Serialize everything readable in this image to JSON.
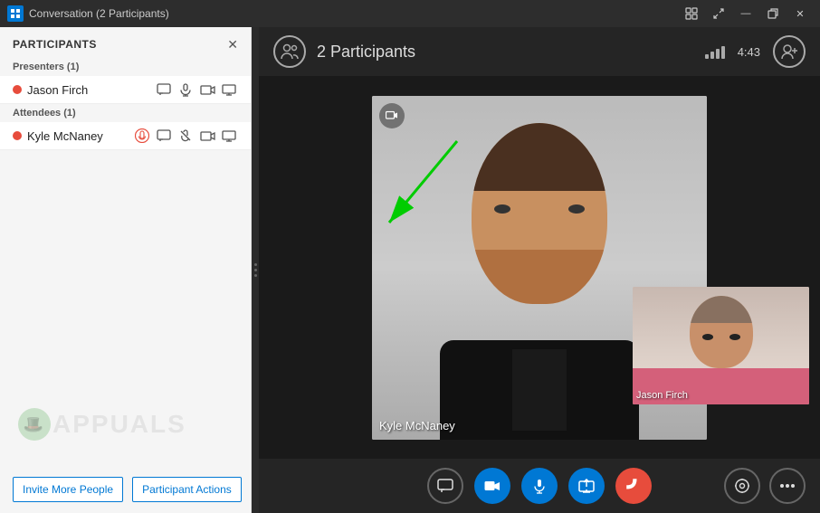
{
  "titleBar": {
    "title": "Conversation (2 Participants)",
    "icon": "S",
    "controls": {
      "snap": "❐",
      "maximize": "□",
      "minimize": "—",
      "restore": "❐",
      "close": "✕"
    }
  },
  "sidebar": {
    "title": "PARTICIPANTS",
    "closeLabel": "✕",
    "presenters": {
      "sectionLabel": "Presenters (1)",
      "items": [
        {
          "name": "Jason Firch",
          "status": "active"
        }
      ]
    },
    "attendees": {
      "sectionLabel": "Attendees (1)",
      "items": [
        {
          "name": "Kyle McNaney",
          "status": "active"
        }
      ]
    },
    "footer": {
      "inviteLabel": "Invite More People",
      "actionsLabel": "Participant Actions"
    }
  },
  "videoArea": {
    "topBar": {
      "participantsLabel": "2 Participants",
      "time": "4:43"
    },
    "mainVideo": {
      "personName": "Kyle McNaney"
    },
    "smallVideo": {
      "personName": "Jason Firch"
    }
  },
  "controls": {
    "chat": "💬",
    "video": "📹",
    "mic": "🎤",
    "share": "⬆",
    "hangup": "📞",
    "more": "…",
    "devices": "📡"
  }
}
